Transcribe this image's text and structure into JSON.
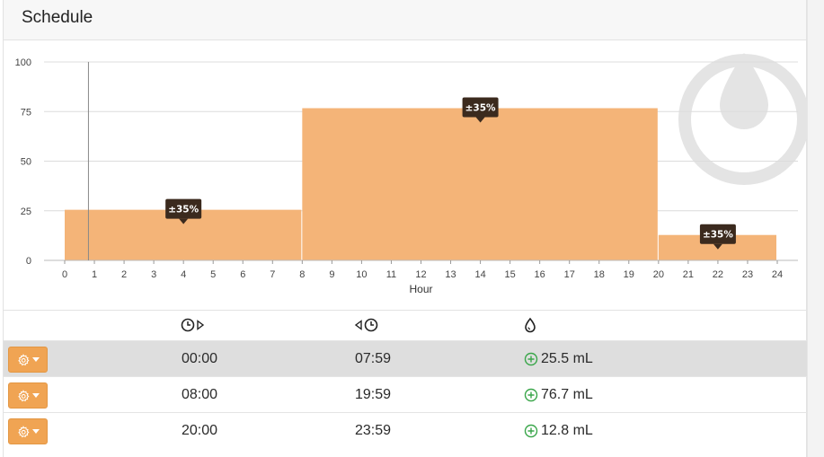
{
  "panel": {
    "title": "Schedule"
  },
  "colors": {
    "bar_fill": "#f4b478",
    "tooltip_bg": "#3b2a1e",
    "button_bg": "#f0a453",
    "add_icon": "#3aa64a",
    "watermark": "#e4e4e4"
  },
  "chart_data": {
    "type": "bar",
    "title": "",
    "xlabel": "Hour",
    "ylabel": "",
    "xlim": [
      0,
      24
    ],
    "ylim": [
      0,
      100
    ],
    "x_ticks": [
      0,
      1,
      2,
      3,
      4,
      5,
      6,
      7,
      8,
      9,
      10,
      11,
      12,
      13,
      14,
      15,
      16,
      17,
      18,
      19,
      20,
      21,
      22,
      23,
      24
    ],
    "y_ticks": [
      0,
      25,
      50,
      75,
      100
    ],
    "grid": true,
    "cursor_hour": 0.8,
    "segments": [
      {
        "start": 0,
        "end": 8,
        "value": 25.5,
        "label": "±35%",
        "label_at": 4
      },
      {
        "start": 8,
        "end": 20,
        "value": 76.7,
        "label": "±35%",
        "label_at": 14
      },
      {
        "start": 20,
        "end": 24,
        "value": 12.8,
        "label": "±35%",
        "label_at": 22
      }
    ]
  },
  "table": {
    "header_icons": [
      "clock-start-icon",
      "clock-end-icon",
      "drop-icon"
    ],
    "rows": [
      {
        "start": "00:00",
        "end": "07:59",
        "volume": "25.5 mL",
        "active": true
      },
      {
        "start": "08:00",
        "end": "19:59",
        "volume": "76.7 mL",
        "active": false
      },
      {
        "start": "20:00",
        "end": "23:59",
        "volume": "12.8 mL",
        "active": false
      }
    ]
  }
}
